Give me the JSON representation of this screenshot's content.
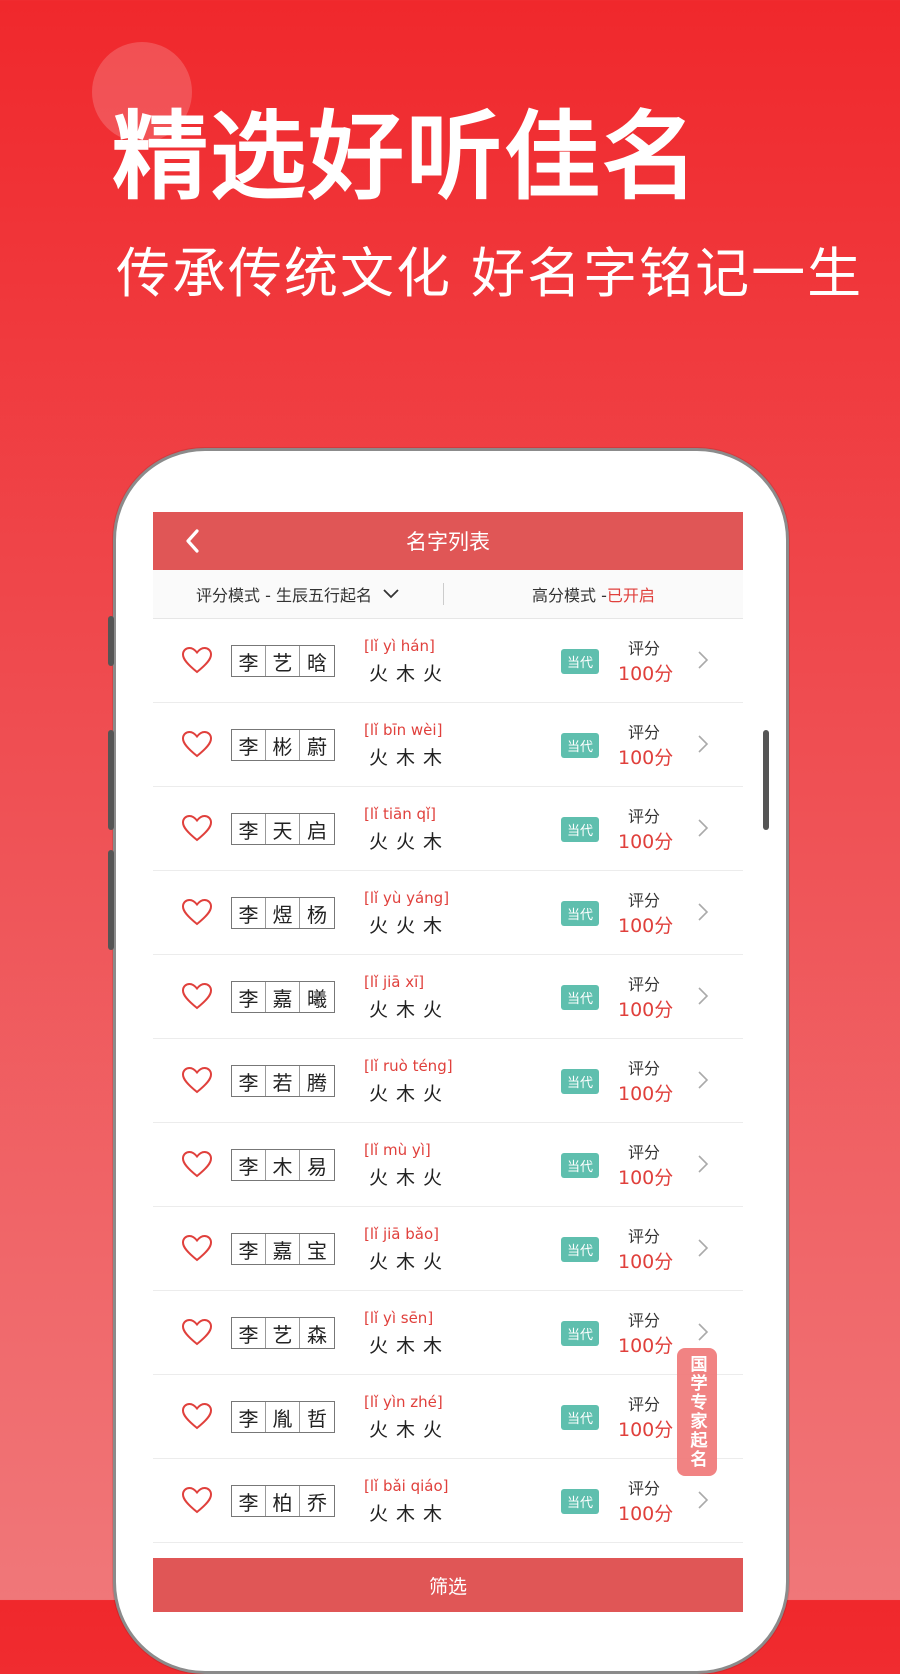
{
  "hero": {
    "title": "精选好听佳名",
    "subtitle": "传承传统文化 好名字铭记一生"
  },
  "appbar": {
    "title": "名字列表",
    "back_icon": "chevron-left-icon"
  },
  "filter": {
    "mode_label": "评分模式 - 生辰五行起名",
    "high_mode_label": "高分模式 - ",
    "high_mode_state": "已开启"
  },
  "names": [
    {
      "chars": [
        "李",
        "艺",
        "晗"
      ],
      "pinyin": "[lǐ yì hán]",
      "elements": "火木火",
      "tag": "当代",
      "score_label": "评分",
      "score": "100分"
    },
    {
      "chars": [
        "李",
        "彬",
        "蔚"
      ],
      "pinyin": "[lǐ bīn wèi]",
      "elements": "火木木",
      "tag": "当代",
      "score_label": "评分",
      "score": "100分"
    },
    {
      "chars": [
        "李",
        "天",
        "启"
      ],
      "pinyin": "[lǐ tiān qǐ]",
      "elements": "火火木",
      "tag": "当代",
      "score_label": "评分",
      "score": "100分"
    },
    {
      "chars": [
        "李",
        "煜",
        "杨"
      ],
      "pinyin": "[lǐ yù yáng]",
      "elements": "火火木",
      "tag": "当代",
      "score_label": "评分",
      "score": "100分"
    },
    {
      "chars": [
        "李",
        "嘉",
        "曦"
      ],
      "pinyin": "[lǐ jiā xī]",
      "elements": "火木火",
      "tag": "当代",
      "score_label": "评分",
      "score": "100分"
    },
    {
      "chars": [
        "李",
        "若",
        "腾"
      ],
      "pinyin": "[lǐ ruò téng]",
      "elements": "火木火",
      "tag": "当代",
      "score_label": "评分",
      "score": "100分"
    },
    {
      "chars": [
        "李",
        "木",
        "易"
      ],
      "pinyin": "[lǐ mù yì]",
      "elements": "火木火",
      "tag": "当代",
      "score_label": "评分",
      "score": "100分"
    },
    {
      "chars": [
        "李",
        "嘉",
        "宝"
      ],
      "pinyin": "[lǐ jiā bǎo]",
      "elements": "火木火",
      "tag": "当代",
      "score_label": "评分",
      "score": "100分"
    },
    {
      "chars": [
        "李",
        "艺",
        "森"
      ],
      "pinyin": "[lǐ yì sēn]",
      "elements": "火木木",
      "tag": "当代",
      "score_label": "评分",
      "score": "100分"
    },
    {
      "chars": [
        "李",
        "胤",
        "哲"
      ],
      "pinyin": "[lǐ yìn zhé]",
      "elements": "火木火",
      "tag": "当代",
      "score_label": "评分",
      "score": "100分"
    },
    {
      "chars": [
        "李",
        "柏",
        "乔"
      ],
      "pinyin": "[lǐ bǎi qiáo]",
      "elements": "火木木",
      "tag": "当代",
      "score_label": "评分",
      "score": "100分"
    }
  ],
  "bottom_button": "筛选",
  "float_badge": "国学专家起名",
  "colors": {
    "primary": "#e05656",
    "accent_red": "#e0403c",
    "tag_green": "#5fbfae"
  }
}
